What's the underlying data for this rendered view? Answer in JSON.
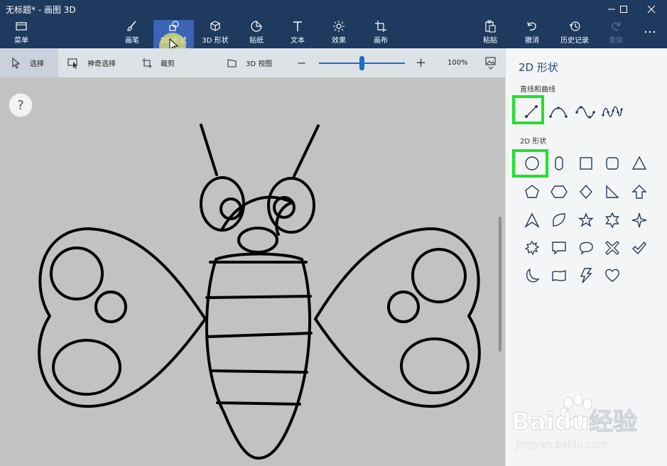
{
  "window": {
    "title": "无标题* - 画图 3D",
    "controls": {
      "minimize_icon": "minimize-icon",
      "maximize_icon": "maximize-icon",
      "close_icon": "close-icon"
    }
  },
  "ribbon": {
    "menu": {
      "label": "菜单",
      "icon": "folder-icon"
    },
    "tools": [
      {
        "label": "画笔",
        "icon": "brush-icon"
      },
      {
        "label": "2D 形状",
        "icon": "2d-shapes-icon",
        "active": true
      },
      {
        "label": "3D 形状",
        "icon": "3d-cube-icon"
      },
      {
        "label": "贴纸",
        "icon": "sticker-icon"
      },
      {
        "label": "文本",
        "icon": "text-icon"
      },
      {
        "label": "效果",
        "icon": "effects-sun-icon"
      },
      {
        "label": "画布",
        "icon": "canvas-icon"
      }
    ],
    "actions": [
      {
        "label": "粘贴",
        "icon": "paste-icon"
      },
      {
        "label": "撤消",
        "icon": "undo-icon"
      },
      {
        "label": "历史记录",
        "icon": "history-icon"
      },
      {
        "label": "重做",
        "icon": "redo-icon",
        "disabled": true
      }
    ],
    "more_icon": "more-icon"
  },
  "toolbar": {
    "select_label": "选择",
    "magic_select_label": "神奇选择",
    "crop_label": "裁剪",
    "view3d_label": "3D 视图",
    "zoom_minus": "−",
    "zoom_plus": "+",
    "zoom_value": "100%",
    "zoom_level": 0.5
  },
  "canvas": {
    "help": "?",
    "background": "#c0c3c2",
    "drawing": "butterfly line drawing"
  },
  "panel": {
    "title": "2D 形状",
    "lines_section": "直线和曲线",
    "shapes_section": "2D 形状",
    "lines": [
      "line-icon",
      "curve-icon",
      "two-point-curve-icon",
      "three-point-curve-icon"
    ],
    "selected_line": "line-icon",
    "shapes": [
      "ellipse-icon",
      "rounded-capsule-icon",
      "rectangle-icon",
      "rounded-square-icon",
      "triangle-icon",
      "pentagon-icon",
      "hexagon-icon",
      "diamond-icon",
      "right-triangle-icon",
      "arrow-up-icon",
      "arrow-head-icon",
      "leaf-icon",
      "star-5-icon",
      "star-6-icon",
      "star-4-icon",
      "burst-icon",
      "speech-bubble-square-icon",
      "speech-bubble-oval-icon",
      "cross-icon",
      "check-icon",
      "moon-icon",
      "banner-icon",
      "lightning-icon",
      "heart-icon"
    ],
    "selected_shape": "ellipse-icon",
    "highlight_color": "#22e02c"
  },
  "watermark": {
    "brand": "Baidu经验",
    "url": "jingyan.baidu.com"
  },
  "colors": {
    "titlebar": "#1f3a5f",
    "accent": "#1a6fc2",
    "active_tab": "#3b63b6"
  }
}
